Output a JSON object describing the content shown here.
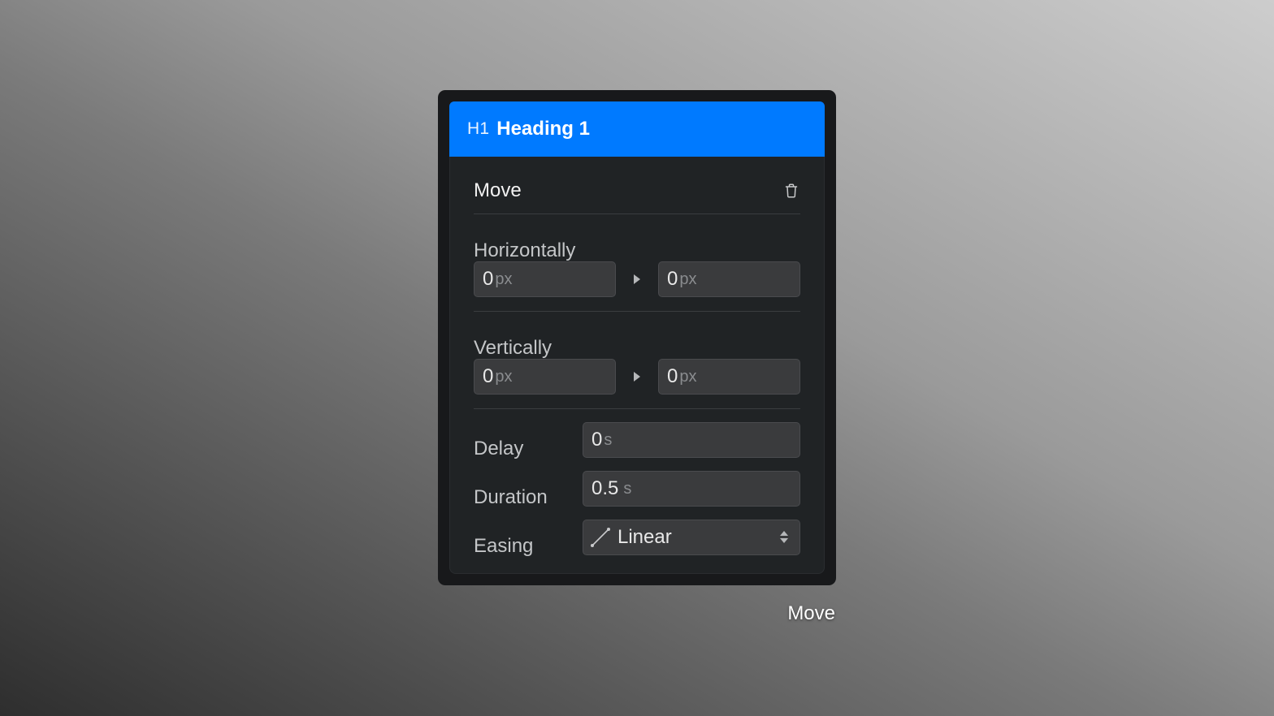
{
  "layer": {
    "tag": "H1",
    "name": "Heading 1"
  },
  "effect": {
    "title": "Move",
    "delete_icon": "trash-icon"
  },
  "horizontally": {
    "label": "Horizontally",
    "from": {
      "value": "0",
      "unit": "px"
    },
    "to": {
      "value": "0",
      "unit": "px"
    }
  },
  "vertically": {
    "label": "Vertically",
    "from": {
      "value": "0",
      "unit": "px"
    },
    "to": {
      "value": "0",
      "unit": "px"
    }
  },
  "delay": {
    "label": "Delay",
    "value": "0",
    "unit": "s"
  },
  "duration": {
    "label": "Duration",
    "value": "0.5",
    "unit": "s"
  },
  "easing": {
    "label": "Easing",
    "selected": "Linear",
    "icon": "linear-curve-icon"
  },
  "caption": "Move",
  "colors": {
    "accent": "#007aff",
    "panel": "#202325",
    "frame": "#18191b",
    "field": "#3a3b3d"
  }
}
